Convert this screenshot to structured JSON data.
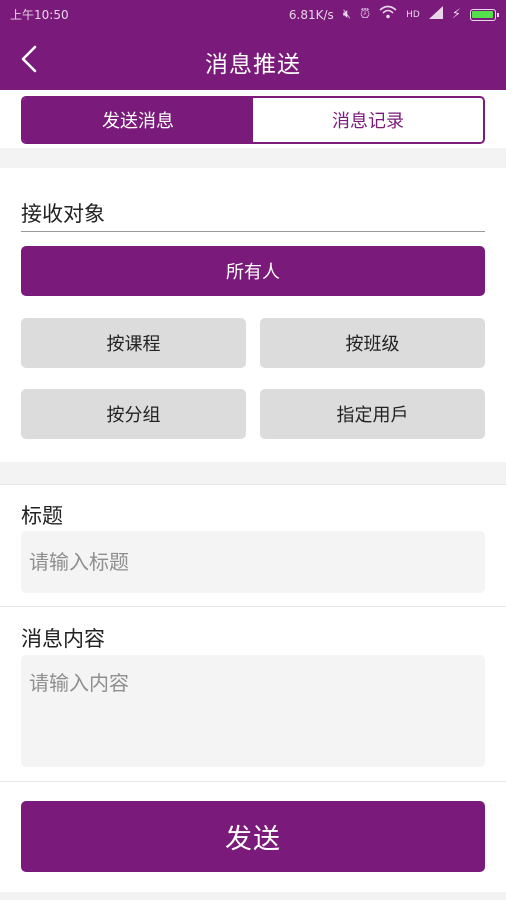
{
  "status_bar": {
    "time": "上午10:50",
    "network_speed": "6.81K/s",
    "network_type": "HD",
    "icons": [
      "mute-icon",
      "alarm-icon",
      "wifi-icon",
      "signal-icon",
      "charging-icon",
      "battery-icon"
    ],
    "battery_level": 1.0
  },
  "header": {
    "title": "消息推送",
    "back_icon": "chevron-left-icon"
  },
  "tabs": [
    {
      "label": "发送消息",
      "active": true
    },
    {
      "label": "消息记录",
      "active": false
    }
  ],
  "recipients": {
    "label": "接收对象",
    "selected": "所有人",
    "options": [
      "按课程",
      "按班级",
      "按分组",
      "指定用戶"
    ]
  },
  "title_field": {
    "label": "标题",
    "value": "",
    "placeholder": "请输入标题"
  },
  "content_field": {
    "label": "消息内容",
    "value": "",
    "placeholder": "请输入内容"
  },
  "send_label": "发送",
  "colors": {
    "brand": "#7a1a7a",
    "option_bg": "#dcdcdc",
    "input_bg": "#f4f4f4",
    "page_bg": "#f3f3f3",
    "battery": "#54e04a"
  }
}
